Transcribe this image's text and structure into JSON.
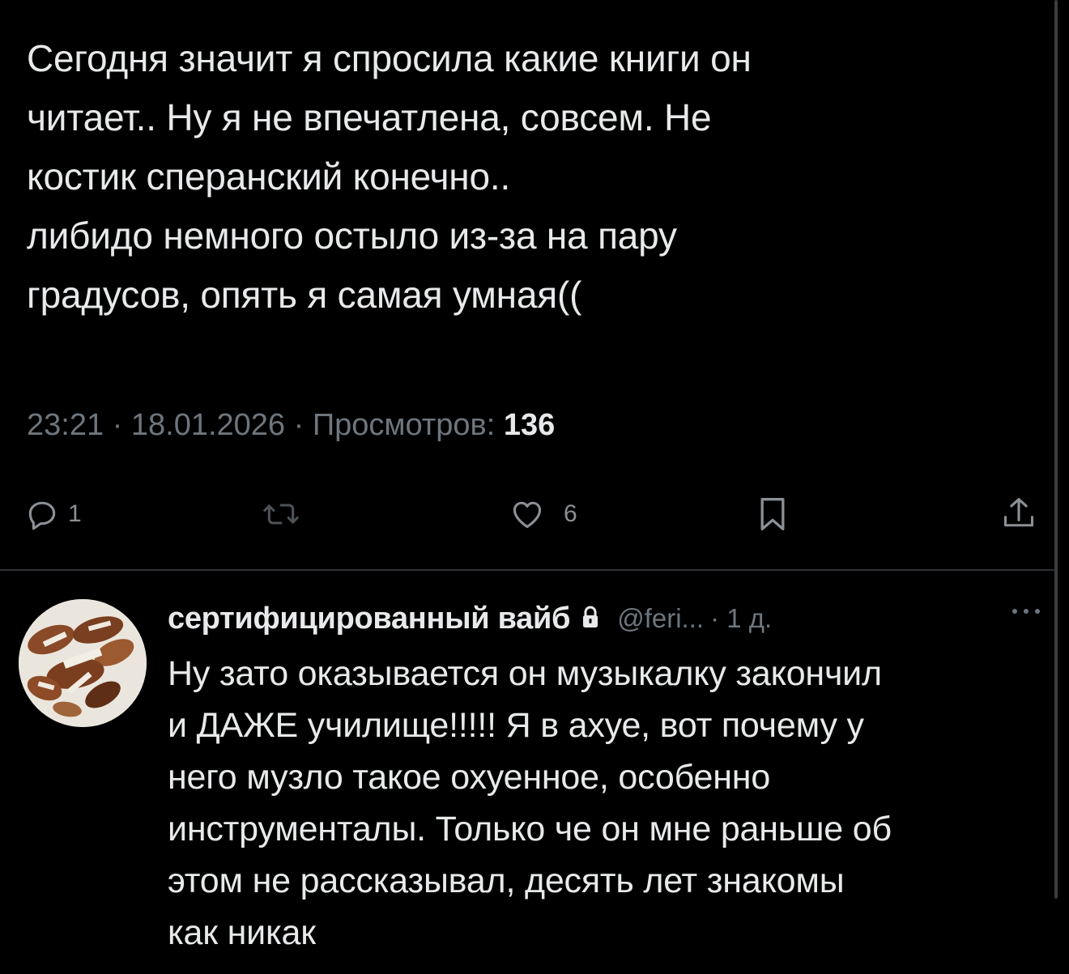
{
  "post": {
    "lines": [
      "Сегодня значит я спросила какие книги он",
      "читает.. Ну я не впечатлена, совсем. Не",
      "костик сперанский конечно..",
      "либидо немного остыло из-за на пару",
      "градусов, опять я самая умная(("
    ],
    "time": "23:21",
    "date": "18.01.2026",
    "views_label": "Просмотров:",
    "views_count": "136",
    "separator": "·"
  },
  "actions": {
    "reply_count": "1",
    "retweet_count": "",
    "like_count": "6"
  },
  "reply": {
    "author_name": "сертифицированный вайб",
    "handle": "@feri...",
    "time": "· 1 д.",
    "lines": [
      "Ну зато оказывается он музыкалку закончил",
      "и ДАЖЕ училище!!!!! Я в ахуе, вот почему у",
      "него музло такое охуенное, особенно",
      "инструменталы. Только че он мне раньше об",
      "этом не рассказывал, десять лет знакомы",
      "как никак"
    ]
  },
  "icons": {
    "reply": "reply-icon",
    "retweet": "retweet-icon",
    "like": "heart-icon",
    "bookmark": "bookmark-icon",
    "share": "share-icon",
    "lock": "lock-icon",
    "more": "more-icon"
  },
  "colors": {
    "background": "#000000",
    "text": "#e7e9ea",
    "secondary": "#6e767d",
    "divider": "#2f3336"
  }
}
